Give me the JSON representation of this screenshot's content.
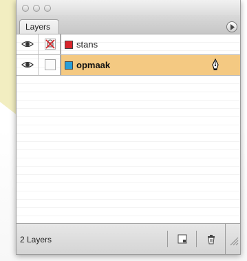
{
  "panel": {
    "tab_label": "Layers",
    "status": "2 Layers"
  },
  "layers": [
    {
      "name": "stans",
      "color": "#d9262c",
      "visible": true,
      "lock_state": "locked-crossed",
      "selected": false
    },
    {
      "name": "opmaak",
      "color": "#2a9fd8",
      "visible": true,
      "lock_state": "unlocked",
      "selected": true,
      "current_drawing_layer_icon": "pen-icon"
    }
  ],
  "icons": {
    "visibility": "eye-icon",
    "lock": "lock-crossed-icon",
    "menu": "panel-menu-icon",
    "new_layer": "new-layer-icon",
    "delete": "trash-icon",
    "resize": "resize-grip-icon"
  },
  "colors": {
    "selected_row": "#f4c982",
    "background_accent": "#f2eec1"
  }
}
